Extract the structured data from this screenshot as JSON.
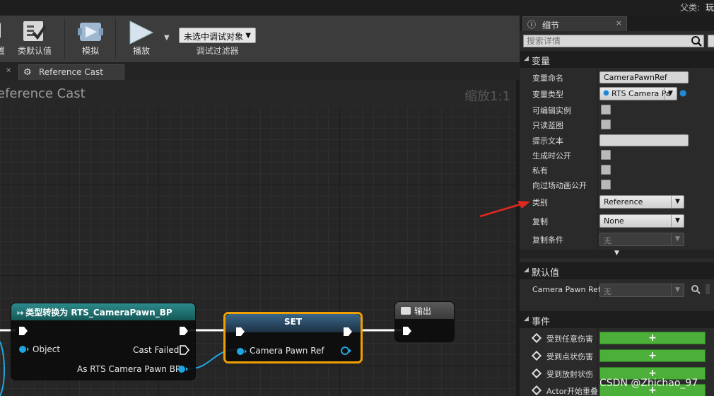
{
  "window": {
    "parent_label": "父类:",
    "parent_value": "玩"
  },
  "toolbar": {
    "buttons": [
      {
        "label": "置"
      },
      {
        "label": "类默认值"
      },
      {
        "label": "模拟"
      },
      {
        "label": "播放"
      }
    ],
    "debug_filter": {
      "value": "未选中调试对象",
      "caption": "调试过滤器"
    }
  },
  "tabs": [
    {
      "label": "Reference Cast",
      "icon": "gear-icon"
    }
  ],
  "graph": {
    "title": "eference Cast",
    "zoom": "缩放1:1",
    "nodes": {
      "cast": {
        "title": "类型转换为 RTS_CameraPawn_BP",
        "pin_object": "Object",
        "pin_cast_failed": "Cast Failed",
        "pin_as": "As RTS Camera Pawn BP",
        "header_color": "#1e6e6e"
      },
      "set": {
        "title": "SET",
        "pin_value": "Camera Pawn Ref",
        "header_color": "#2a4c66"
      },
      "output": {
        "title": "输出",
        "icon": "output-icon"
      }
    }
  },
  "details": {
    "tab_label": "细节",
    "search_placeholder": "搜索详情",
    "sections": {
      "variable": "变量",
      "defaults": "默认值",
      "events": "事件"
    },
    "variable_rows": {
      "name": {
        "label": "变量命名",
        "value": "CameraPawnRef"
      },
      "type": {
        "label": "变量类型",
        "value": "RTS Camera Pa"
      },
      "editable": {
        "label": "可编辑实例"
      },
      "readonly": {
        "label": "只读蓝图"
      },
      "tooltip": {
        "label": "提示文本",
        "value": ""
      },
      "expose_spawn": {
        "label": "生成时公开"
      },
      "private": {
        "label": "私有"
      },
      "expose_cinematics": {
        "label": "向过场动画公开"
      },
      "category": {
        "label": "类别",
        "value": "Reference"
      },
      "replication": {
        "label": "复制",
        "value": "None"
      },
      "rep_condition": {
        "label": "复制条件",
        "value": "无"
      }
    },
    "default_row": {
      "label": "Camera Pawn Ref",
      "value": "无"
    },
    "event_rows": [
      {
        "label": "受到任意伤害"
      },
      {
        "label": "受到点状伤害"
      },
      {
        "label": "受到放射状伤"
      },
      {
        "label": "Actor开始重叠"
      }
    ]
  },
  "watermark": "CSDN @Zhichao_97",
  "colors": {
    "accent_green": "#4caf3a",
    "highlight_orange": "#f0a000",
    "annotation_red": "#e0281e"
  }
}
